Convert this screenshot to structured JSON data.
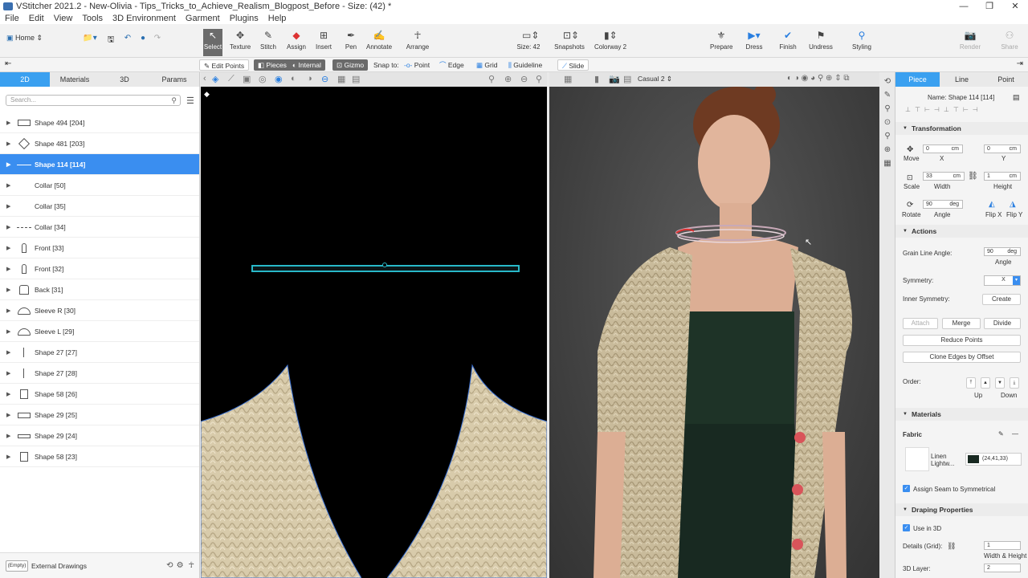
{
  "title": "VStitcher 2021.2 - New-Olivia - Tips_Tricks_to_Achieve_Realism_Blogpost_Before - Size: (42) *",
  "menu": [
    "File",
    "Edit",
    "View",
    "Tools",
    "3D Environment",
    "Garment",
    "Plugins",
    "Help"
  ],
  "home_label": "Home",
  "toolbar": {
    "select": "Select",
    "texture": "Texture",
    "stitch": "Stitch",
    "assign": "Assign",
    "insert": "Insert",
    "pen": "Pen",
    "annotate": "Annotate",
    "arrange": "Arrange",
    "size": "Size: 42",
    "snapshots": "Snapshots",
    "colorway": "Colorway 2",
    "prepare": "Prepare",
    "dress": "Dress",
    "finish": "Finish",
    "undress": "Undress",
    "styling": "Styling",
    "render": "Render",
    "share": "Share"
  },
  "subbar": {
    "edit_points": "Edit Points",
    "pieces": "Pieces",
    "internal": "Internal",
    "gizmo": "Gizmo",
    "snap_to": "Snap to:",
    "point": "Point",
    "edge": "Edge",
    "grid": "Grid",
    "guideline": "Guideline",
    "slide": "Slide"
  },
  "left_tabs": [
    "2D",
    "Materials",
    "3D",
    "Params"
  ],
  "search_placeholder": "Search...",
  "tree": [
    {
      "label": "Shape 494 [204]"
    },
    {
      "label": "Shape 481 [203]"
    },
    {
      "label": "Shape 114 [114]"
    },
    {
      "label": "Collar [50]"
    },
    {
      "label": "Collar [35]"
    },
    {
      "label": "Collar [34]"
    },
    {
      "label": "Front [33]"
    },
    {
      "label": "Front [32]"
    },
    {
      "label": "Back [31]"
    },
    {
      "label": "Sleeve R [30]"
    },
    {
      "label": "Sleeve L [29]"
    },
    {
      "label": "Shape 27 [27]"
    },
    {
      "label": "Shape 27 [28]"
    },
    {
      "label": "Shape 58 [26]"
    },
    {
      "label": "Shape 29 [25]"
    },
    {
      "label": "Shape 29 [24]"
    },
    {
      "label": "Shape 58 [23]"
    }
  ],
  "external": {
    "empty": "(Empty)",
    "label": "External Drawings"
  },
  "view3d": {
    "camera": "Casual 2"
  },
  "right_tabs": [
    "Piece",
    "Line",
    "Point"
  ],
  "piece": {
    "name": "Name: Shape 114 [114]",
    "transformation": "Transformation",
    "move": "Move",
    "x_val": "0",
    "x_unit": "cm",
    "x_lbl": "X",
    "y_val": "0",
    "y_unit": "cm",
    "y_lbl": "Y",
    "scale": "Scale",
    "w_val": "33",
    "w_unit": "cm",
    "w_lbl": "Width",
    "h_val": "1",
    "h_unit": "cm",
    "h_lbl": "Height",
    "rotate": "Rotate",
    "angle_val": "90",
    "angle_unit": "deg",
    "angle_lbl": "Angle",
    "flipx": "Flip X",
    "flipy": "Flip Y",
    "actions": "Actions",
    "grain": "Grain Line Angle:",
    "grain_val": "90",
    "grain_unit": "deg",
    "grain_lbl": "Angle",
    "symmetry": "Symmetry:",
    "sym_val": "X",
    "inner_sym": "Inner Symmetry:",
    "create": "Create",
    "attach": "Attach",
    "merge": "Merge",
    "divide": "Divide",
    "reduce": "Reduce Points",
    "clone": "Clone Edges by Offset",
    "order": "Order:",
    "up": "Up",
    "down": "Down",
    "materials": "Materials",
    "fabric": "Fabric",
    "fabric_name": "Linen Lightw...",
    "fabric_color": "(24,41,33)",
    "fabric_hex": "#182921",
    "assign_seam": "Assign Seam to Symmetrical",
    "draping": "Draping Properties",
    "use3d": "Use in 3D",
    "details": "Details (Grid):",
    "details_val": "1",
    "wh": "Width & Height",
    "layer": "3D Layer:",
    "layer_val": "2"
  }
}
